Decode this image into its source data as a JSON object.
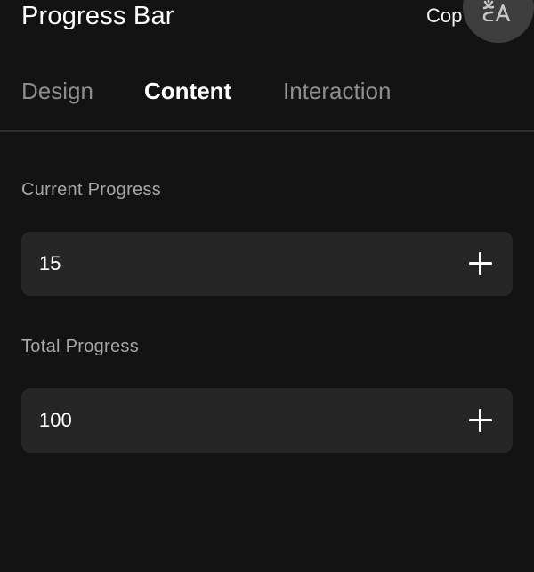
{
  "header": {
    "title": "Progress Bar",
    "copy_label": "Cop",
    "translate_icon": "translate-icon"
  },
  "tabs": [
    {
      "label": "Design",
      "active": false
    },
    {
      "label": "Content",
      "active": true
    },
    {
      "label": "Interaction",
      "active": false
    }
  ],
  "fields": {
    "current": {
      "label": "Current Progress",
      "value": "15",
      "action_icon": "plus-icon"
    },
    "total": {
      "label": "Total Progress",
      "value": "100",
      "action_icon": "plus-icon"
    }
  },
  "colors": {
    "background": "#131313",
    "field_background": "#262626",
    "active_tab": "#ffffff",
    "inactive_tab": "#8e8e8e",
    "label": "#a6a6a6"
  }
}
